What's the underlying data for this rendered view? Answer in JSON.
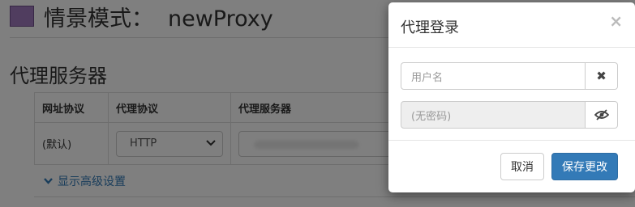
{
  "header": {
    "color_swatch": "#a07abf",
    "label": "情景模式：",
    "profile_name": "newProxy"
  },
  "section": {
    "title": "代理服务器"
  },
  "table": {
    "headers": [
      "网址协议",
      "代理协议",
      "代理服务器"
    ],
    "row": {
      "url_protocol": "(默认)",
      "proxy_protocol": "HTTP"
    }
  },
  "advanced": {
    "label": "显示高级设置",
    "color": "#337ab7"
  },
  "modal": {
    "title": "代理登录",
    "close_symbol": "×",
    "username": {
      "placeholder": "用户名",
      "clear_icon": "times-icon",
      "clear_symbol": "✖"
    },
    "password": {
      "placeholder": "(无密码)",
      "reveal_icon": "eye-slash-icon"
    },
    "cancel_label": "取消",
    "save_label": "保存更改",
    "primary_color": "#337ab7"
  }
}
